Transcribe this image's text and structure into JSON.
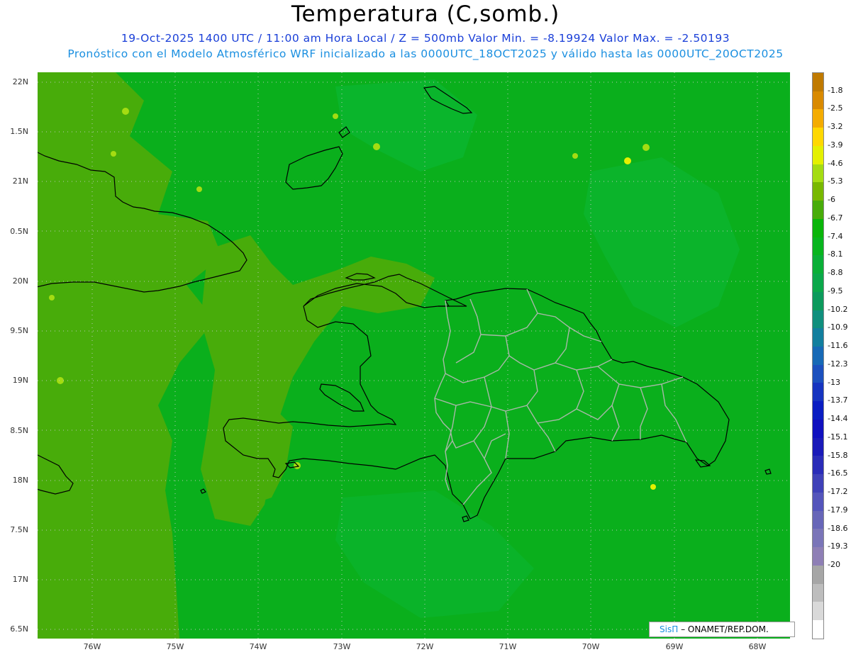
{
  "title": "Temperatura (C,somb.)",
  "subtitle_1": "19-Oct-2025  1400 UTC / 11:00 am Hora Local / Z = 500mb  Valor Min. = -8.19924  Valor Max. = -2.50193",
  "subtitle_2": "Pronóstico con el Modelo Atmosférico WRF inicializado a las 0000UTC_18OCT2025 y válido hasta las  0000UTC_20OCT2025",
  "y_axis": [
    {
      "label": "22N"
    },
    {
      "label": "1.5N"
    },
    {
      "label": "21N"
    },
    {
      "label": "0.5N"
    },
    {
      "label": "20N"
    },
    {
      "label": "9.5N"
    },
    {
      "label": "19N"
    },
    {
      "label": "8.5N"
    },
    {
      "label": "18N"
    },
    {
      "label": "7.5N"
    },
    {
      "label": "17N"
    },
    {
      "label": "6.5N"
    }
  ],
  "x_axis": [
    {
      "label": "76W"
    },
    {
      "label": "75W"
    },
    {
      "label": "74W"
    },
    {
      "label": "73W"
    },
    {
      "label": "72W"
    },
    {
      "label": "71W"
    },
    {
      "label": "70W"
    },
    {
      "label": "69W"
    },
    {
      "label": "68W"
    }
  ],
  "colorbar": {
    "colors": [
      "#ffffff",
      "#d9d9d9",
      "#bdbdbd",
      "#a6a6a6",
      "#8e7fb5",
      "#7a75b8",
      "#6766b8",
      "#5455bb",
      "#3f41b8",
      "#2a2cb8",
      "#1a1ab9",
      "#1010bf",
      "#0a1dc2",
      "#1634c0",
      "#1c50be",
      "#1769b6",
      "#127f9e",
      "#108f7d",
      "#0c9a5c",
      "#0ba84a",
      "#0aaf37",
      "#08b51e",
      "#0ab50a",
      "#48ac0a",
      "#78b800",
      "#a4dc12",
      "#e4f000",
      "#ffd800",
      "#f4ac00",
      "#d98a00",
      "#c07a00"
    ],
    "labels": [
      "-1.8",
      "-2.5",
      "-3.2",
      "-3.9",
      "-4.6",
      "-5.3",
      "-6",
      "-6.7",
      "-7.4",
      "-8.1",
      "-8.8",
      "-9.5",
      "-10.2",
      "-10.9",
      "-11.6",
      "-12.3",
      "-13",
      "-13.7",
      "-14.4",
      "-15.1",
      "-15.8",
      "-16.5",
      "-17.2",
      "-17.9",
      "-18.6",
      "-19.3",
      "-20"
    ]
  },
  "credit": {
    "brand": "SisΠ",
    "org": "– ONAMET/REP.DOM."
  }
}
